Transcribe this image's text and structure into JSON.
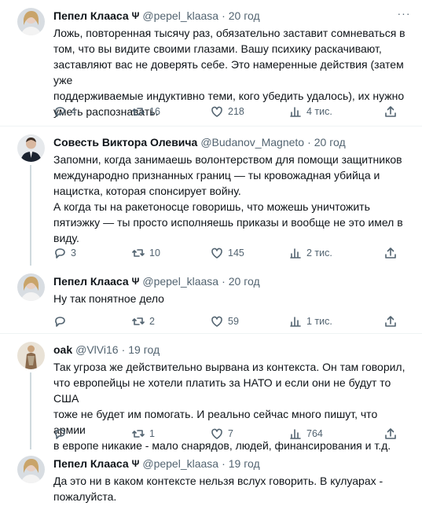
{
  "tweets": [
    {
      "name": "Пепел Клааса",
      "handle": "@pepel_klaasa",
      "sep": "·",
      "time": "20 год",
      "text": "Ложь, повторенная тысячу раз, обязательно заставит сомневаться в\nтом, что вы видите своими глазами. Вашу психику раскачивают,\nзаставляют вас не доверять себе. Это намеренные действия (затем уже\nподдерживаемые индуктивно теми, кого убедить удалось), их нужно\nуметь распознавать.",
      "replies": "4",
      "retweets": "16",
      "likes": "218",
      "views": "4 тис."
    },
    {
      "name": "Совесть Виктора Олевича",
      "handle": "@Budanov_Magneto",
      "sep": "·",
      "time": "20 год",
      "text": "Запомни, когда занимаешь волонтерством для помощи защитников\nмеждународно признанных границ — ты кровожадная убийца и\nнацистка, которая спонсирует войну.\nА когда ты на ракетоносце говоришь, что можешь уничтожить\nпятиэжку — ты просто исполняешь приказы и вообще не это имел в\nвиду.",
      "replies": "3",
      "retweets": "10",
      "likes": "145",
      "views": "2 тис."
    },
    {
      "name": "Пепел Клааса",
      "handle": "@pepel_klaasa",
      "sep": "·",
      "time": "20 год",
      "text": "Ну так понятное дело",
      "replies": "",
      "retweets": "2",
      "likes": "59",
      "views": "1 тис."
    },
    {
      "name": "oak",
      "handle": "@VlVi16",
      "sep": "·",
      "time": "19 год",
      "text": "Так угроза же действительно вырвана из контекста. Он там говорил,\nчто европейцы не хотели платить за НАТО и если они не будут то США\nтоже не будет им помогать. И реально сейчас много пишут, что армии\nв европе никакие - мало снарядов, людей, финансирования и т.д.",
      "replies": "",
      "retweets": "1",
      "likes": "7",
      "views": "764"
    },
    {
      "name": "Пепел Клааса",
      "handle": "@pepel_klaasa",
      "sep": "·",
      "time": "19 год",
      "text": "Да это ни в каком контексте нельзя вслух говорить. В кулуарах -\nпожалуйста."
    }
  ],
  "icons": {
    "reply": "reply-icon",
    "retweet": "retweet-icon",
    "like": "heart-icon",
    "views": "views-icon",
    "share": "share-icon",
    "more": "more-icon",
    "badge": "ukraine-trident-badge-icon"
  },
  "colors": {
    "text": "#0f1419",
    "secondary": "#536471",
    "divider": "#eff3f4",
    "thread": "#cfd9de"
  }
}
